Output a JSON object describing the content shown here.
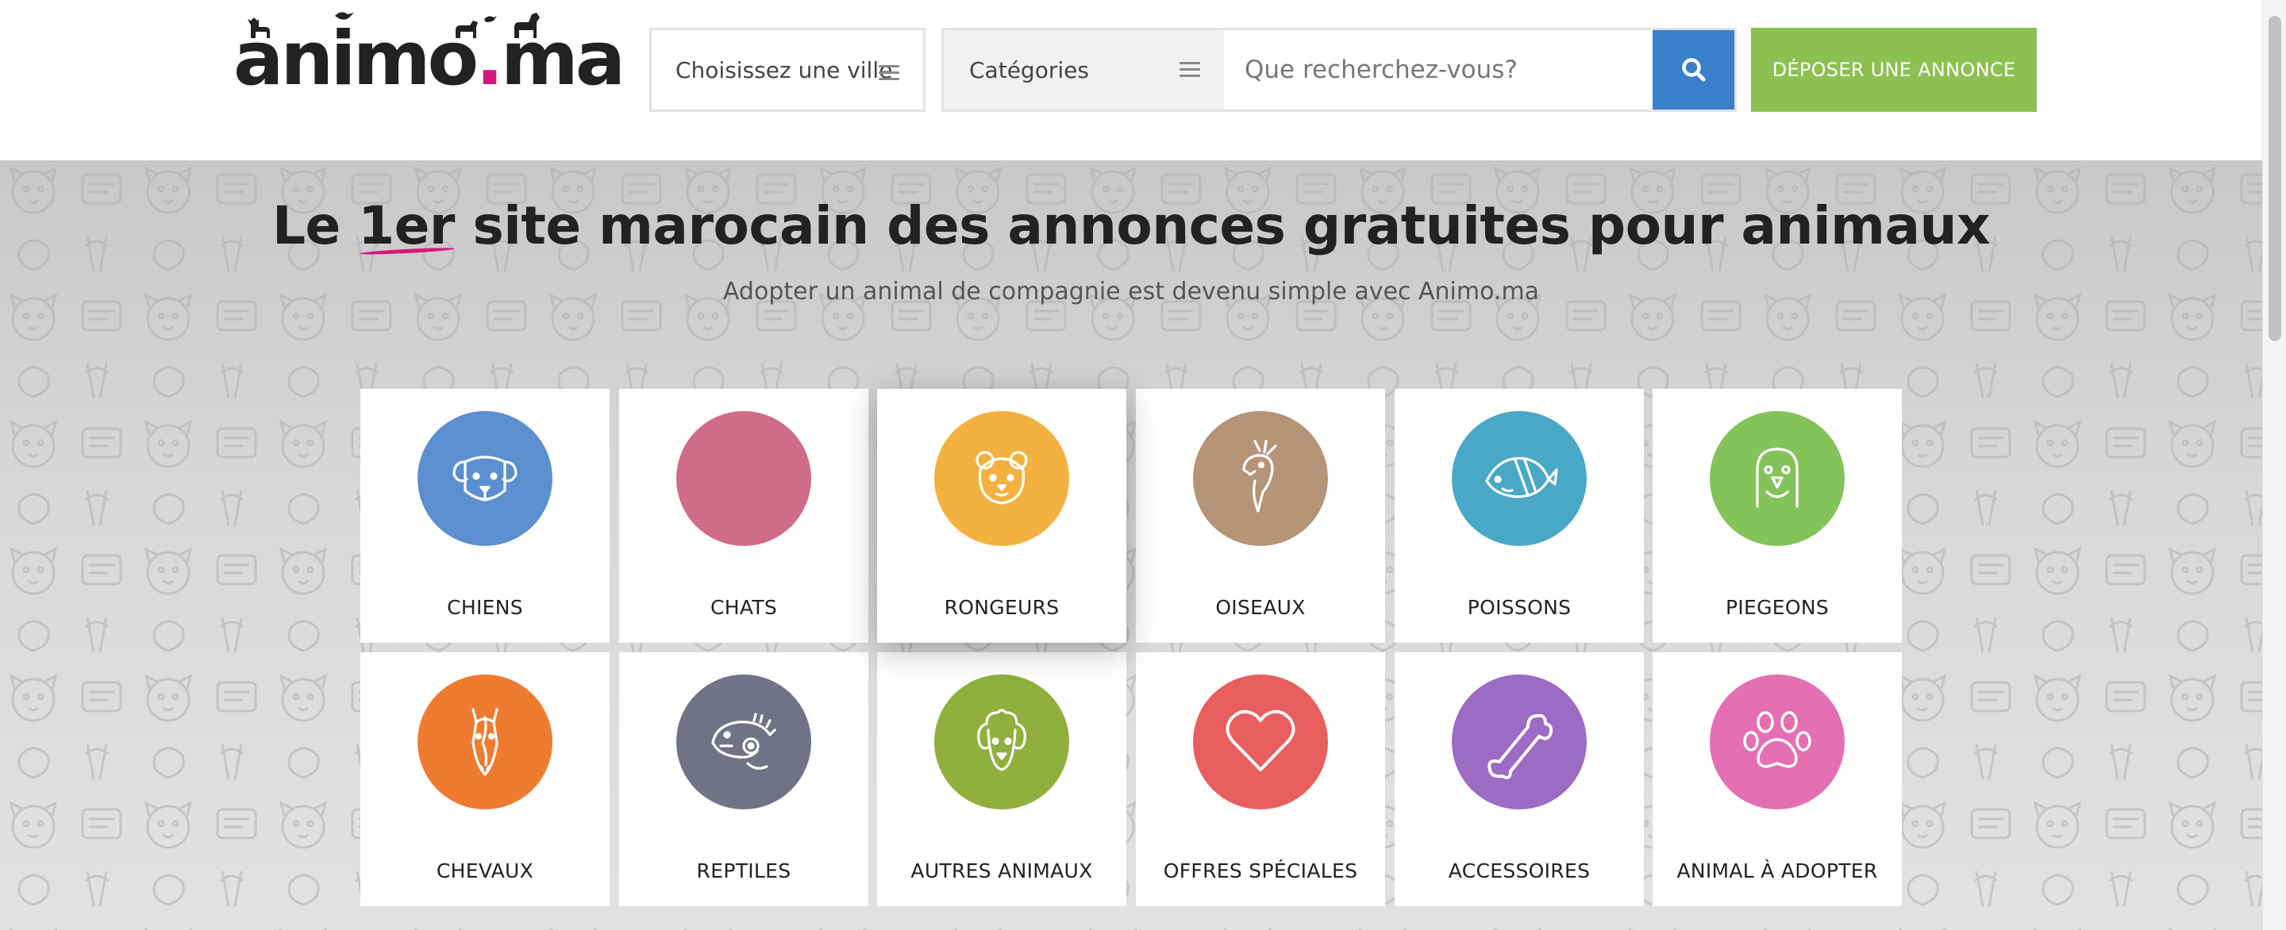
{
  "header": {
    "logo_text": "animo",
    "logo_dot": ".",
    "logo_suffix": "ma",
    "city_select": {
      "label": "Choisissez une ville"
    },
    "category_select": {
      "label": "Catégories"
    },
    "search": {
      "placeholder": "Que recherchez-vous?",
      "value": ""
    },
    "post_button": "DÉPOSER UNE ANNONCE"
  },
  "hero": {
    "title_before": "Le ",
    "title_accent": "1er",
    "title_after": " site marocain des annonces gratuites pour animaux",
    "subtitle": "Adopter un animal de compagnie est devenu simple avec Animo.ma"
  },
  "categories": [
    {
      "label": "CHIENS",
      "color": "#5b8fd0",
      "icon": "dog-icon"
    },
    {
      "label": "CHATS",
      "color": "#cf6d89",
      "icon": "cat-icon"
    },
    {
      "label": "RONGEURS",
      "color": "#f3b13f",
      "icon": "hamster-icon"
    },
    {
      "label": "OISEAUX",
      "color": "#b59478",
      "icon": "parrot-icon"
    },
    {
      "label": "POISSONS",
      "color": "#4aa8c7",
      "icon": "fish-icon"
    },
    {
      "label": "PIEGEONS",
      "color": "#84c25a",
      "icon": "pigeon-icon"
    },
    {
      "label": "CHEVAUX",
      "color": "#ef7b30",
      "icon": "horse-icon"
    },
    {
      "label": "REPTILES",
      "color": "#727286",
      "icon": "iguana-icon"
    },
    {
      "label": "AUTRES ANIMAUX",
      "color": "#8fb03c",
      "icon": "poodle-icon"
    },
    {
      "label": "OFFRES SPÉCIALES",
      "color": "#e85e5e",
      "icon": "heart-icon"
    },
    {
      "label": "ACCESSOIRES",
      "color": "#9c6bc3",
      "icon": "bone-icon"
    },
    {
      "label": "ANIMAL À ADOPTER",
      "color": "#e46fb2",
      "icon": "paw-icon"
    }
  ],
  "colors": {
    "search_button": "#3a7fc9",
    "post_button": "#8cc152",
    "accent": "#d6177c"
  }
}
